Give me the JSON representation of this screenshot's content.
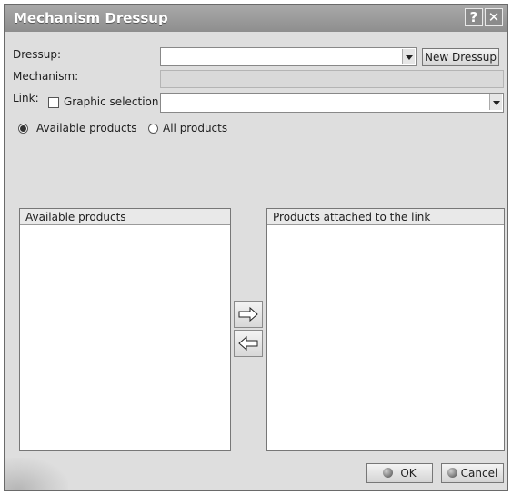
{
  "window": {
    "title": "Mechanism Dressup",
    "help_label": "?",
    "close_label": "✕"
  },
  "dressup": {
    "label": "Dressup:",
    "value": "",
    "new_button_label": "New Dressup"
  },
  "mechanism": {
    "label": "Mechanism:",
    "value": ""
  },
  "link": {
    "label": "Link:",
    "graphic_selection_label": "Graphic selection",
    "graphic_selection_checked": false,
    "value": ""
  },
  "filter": {
    "options": [
      {
        "label": "Available products",
        "selected": true
      },
      {
        "label": "All products",
        "selected": false
      }
    ]
  },
  "lists": {
    "available_header": "Available products",
    "attached_header": "Products attached to the link",
    "available_items": [],
    "attached_items": []
  },
  "move": {
    "add_icon": "right-arrow-icon",
    "remove_icon": "left-arrow-icon"
  },
  "footer": {
    "ok_label": "OK",
    "cancel_label": "Cancel"
  }
}
